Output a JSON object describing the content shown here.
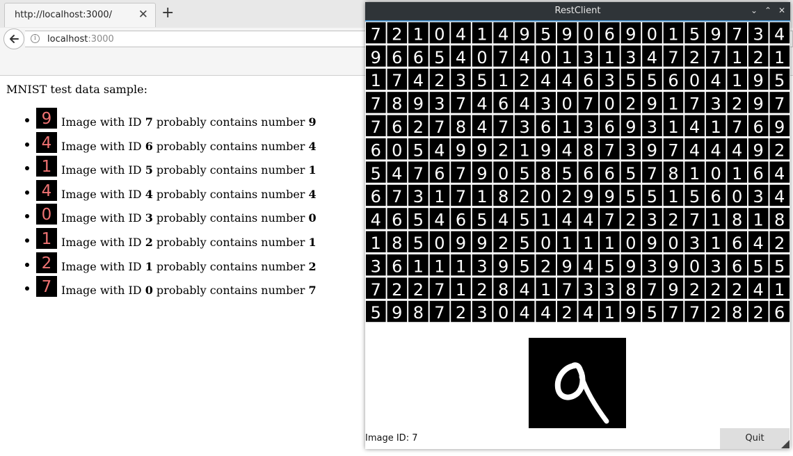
{
  "browser": {
    "tab_title": "http://localhost:3000/",
    "tab_close": "✕",
    "new_tab": "+",
    "url_host": "localhost",
    "url_port": ":3000",
    "info_glyph": "i"
  },
  "page": {
    "title": "MNIST test data sample:",
    "results": [
      {
        "prefix": "Image with ID ",
        "id": "7",
        "middle": " probably contains number ",
        "number": "9"
      },
      {
        "prefix": "Image with ID ",
        "id": "6",
        "middle": " probably contains number ",
        "number": "4"
      },
      {
        "prefix": "Image with ID ",
        "id": "5",
        "middle": " probably contains number ",
        "number": "1"
      },
      {
        "prefix": "Image with ID ",
        "id": "4",
        "middle": " probably contains number ",
        "number": "4"
      },
      {
        "prefix": "Image with ID ",
        "id": "3",
        "middle": " probably contains number ",
        "number": "0"
      },
      {
        "prefix": "Image with ID ",
        "id": "2",
        "middle": " probably contains number ",
        "number": "1"
      },
      {
        "prefix": "Image with ID ",
        "id": "1",
        "middle": " probably contains number ",
        "number": "2"
      },
      {
        "prefix": "Image with ID ",
        "id": "0",
        "middle": " probably contains number ",
        "number": "7"
      }
    ]
  },
  "restclient": {
    "title": "RestClient",
    "buttons": {
      "minimize": "⌄",
      "maximize": "⌃",
      "close": "✕"
    },
    "grid_rows": [
      "72104149590690159734",
      "96654074013134727121",
      "17423512446355604195",
      "78937464307029173297",
      "76278473613693141769",
      "60549921948739744492",
      "54767905856657810164",
      "67317182029955156034",
      "46546545144723271818",
      "18509925011109031642",
      "36111395294593903655",
      "72271284173387922241",
      "59872304424195772826"
    ],
    "status_label": "Image ID: 7",
    "quit_label": "Quit"
  },
  "colors": {
    "thumb_digit": "#f07373",
    "grid_digit": "#ffffff",
    "titlebar": "#2f3438",
    "accent": "#4a90c8"
  }
}
